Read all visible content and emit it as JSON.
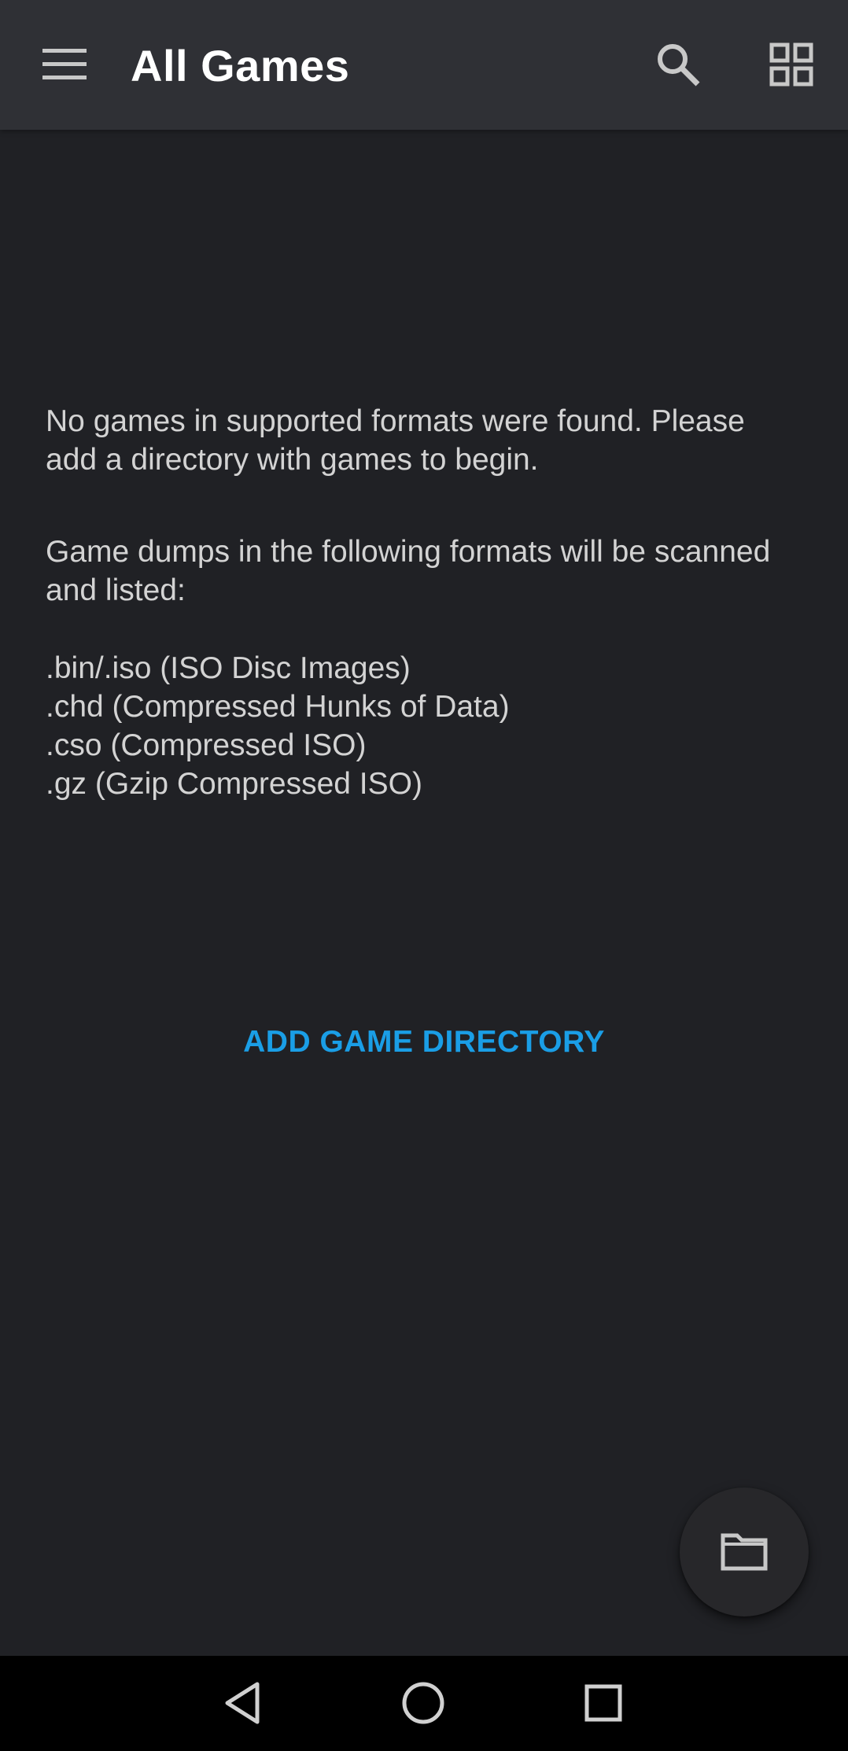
{
  "appbar": {
    "title": "All Games",
    "menu_icon": "hamburger-menu-icon",
    "search_icon": "search-icon",
    "view_icon": "grid-view-icon"
  },
  "empty_state": {
    "message": "No games in supported formats were found. Please add a directory with games to begin.",
    "formats_intro": "Game dumps in the following formats will be scanned and listed:",
    "formats": [
      ".bin/.iso (ISO Disc Images)",
      ".chd (Compressed Hunks of Data)",
      ".cso (Compressed ISO)",
      ".gz (Gzip Compressed ISO)"
    ],
    "add_button_label": "ADD GAME DIRECTORY"
  },
  "fab": {
    "icon": "folder-icon"
  },
  "navbar": {
    "back_icon": "back-triangle-icon",
    "home_icon": "home-circle-icon",
    "recents_icon": "recents-square-icon"
  },
  "colors": {
    "background": "#202125",
    "appbar": "#2f3035",
    "text": "#d3d3d3",
    "accent": "#1a9ee6",
    "navbar": "#000000"
  }
}
